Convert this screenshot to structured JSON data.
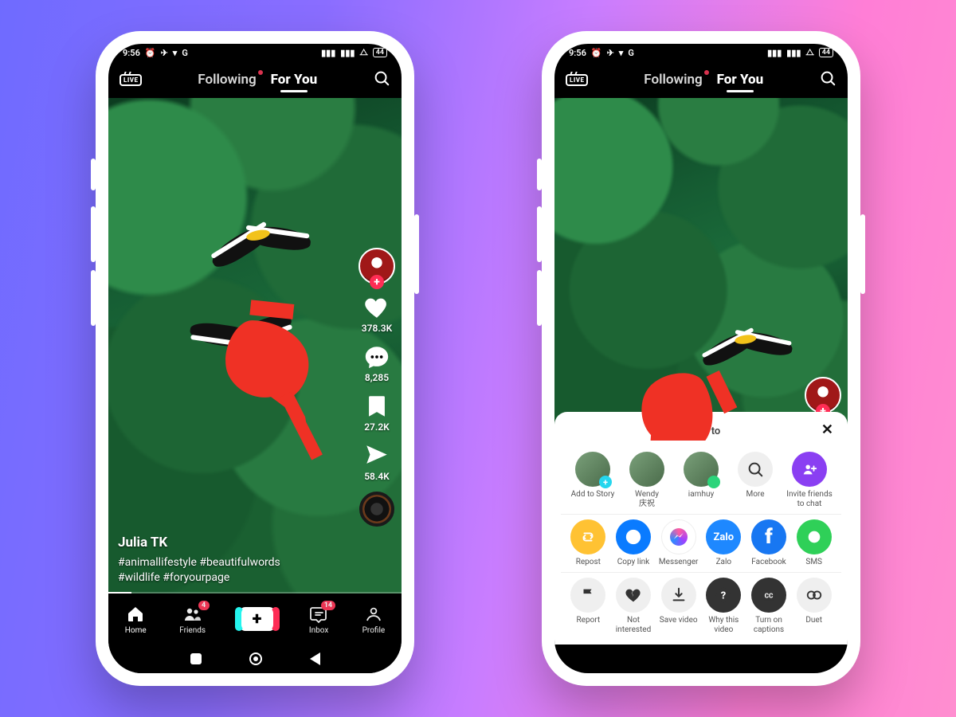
{
  "status": {
    "time": "9:56",
    "battery": "44"
  },
  "topnav": {
    "live": "LIVE",
    "following": "Following",
    "foryou": "For You"
  },
  "rail": {
    "likes": "378.3K",
    "comments": "8,285",
    "saves": "27.2K",
    "shares": "58.4K"
  },
  "post": {
    "author": "Julia TK",
    "caption_l1": "#animallifestyle #beautifulwords",
    "caption_l2": "#wildlife #foryourpage"
  },
  "bottomnav": {
    "home": "Home",
    "friends": "Friends",
    "inbox": "Inbox",
    "profile": "Profile",
    "friends_badge": "4",
    "inbox_badge": "14"
  },
  "share": {
    "title": "Share to",
    "row1": {
      "add_story": "Add to Story",
      "wendy_l1": "Wendy",
      "wendy_l2": "庆祝",
      "iamhuy": "iamhuy",
      "more": "More",
      "invite_l1": "Invite friends",
      "invite_l2": "to chat"
    },
    "row2": {
      "repost": "Repost",
      "copylink": "Copy link",
      "messenger": "Messenger",
      "zalo": "Zalo",
      "zalo_label": "Zalo",
      "facebook": "Facebook",
      "sms": "SMS"
    },
    "row3": {
      "report": "Report",
      "notint_l1": "Not",
      "notint_l2": "interested",
      "save": "Save video",
      "why_l1": "Why this",
      "why_l2": "video",
      "cap_l1": "Turn on",
      "cap_l2": "captions",
      "duet": "Duet"
    }
  }
}
